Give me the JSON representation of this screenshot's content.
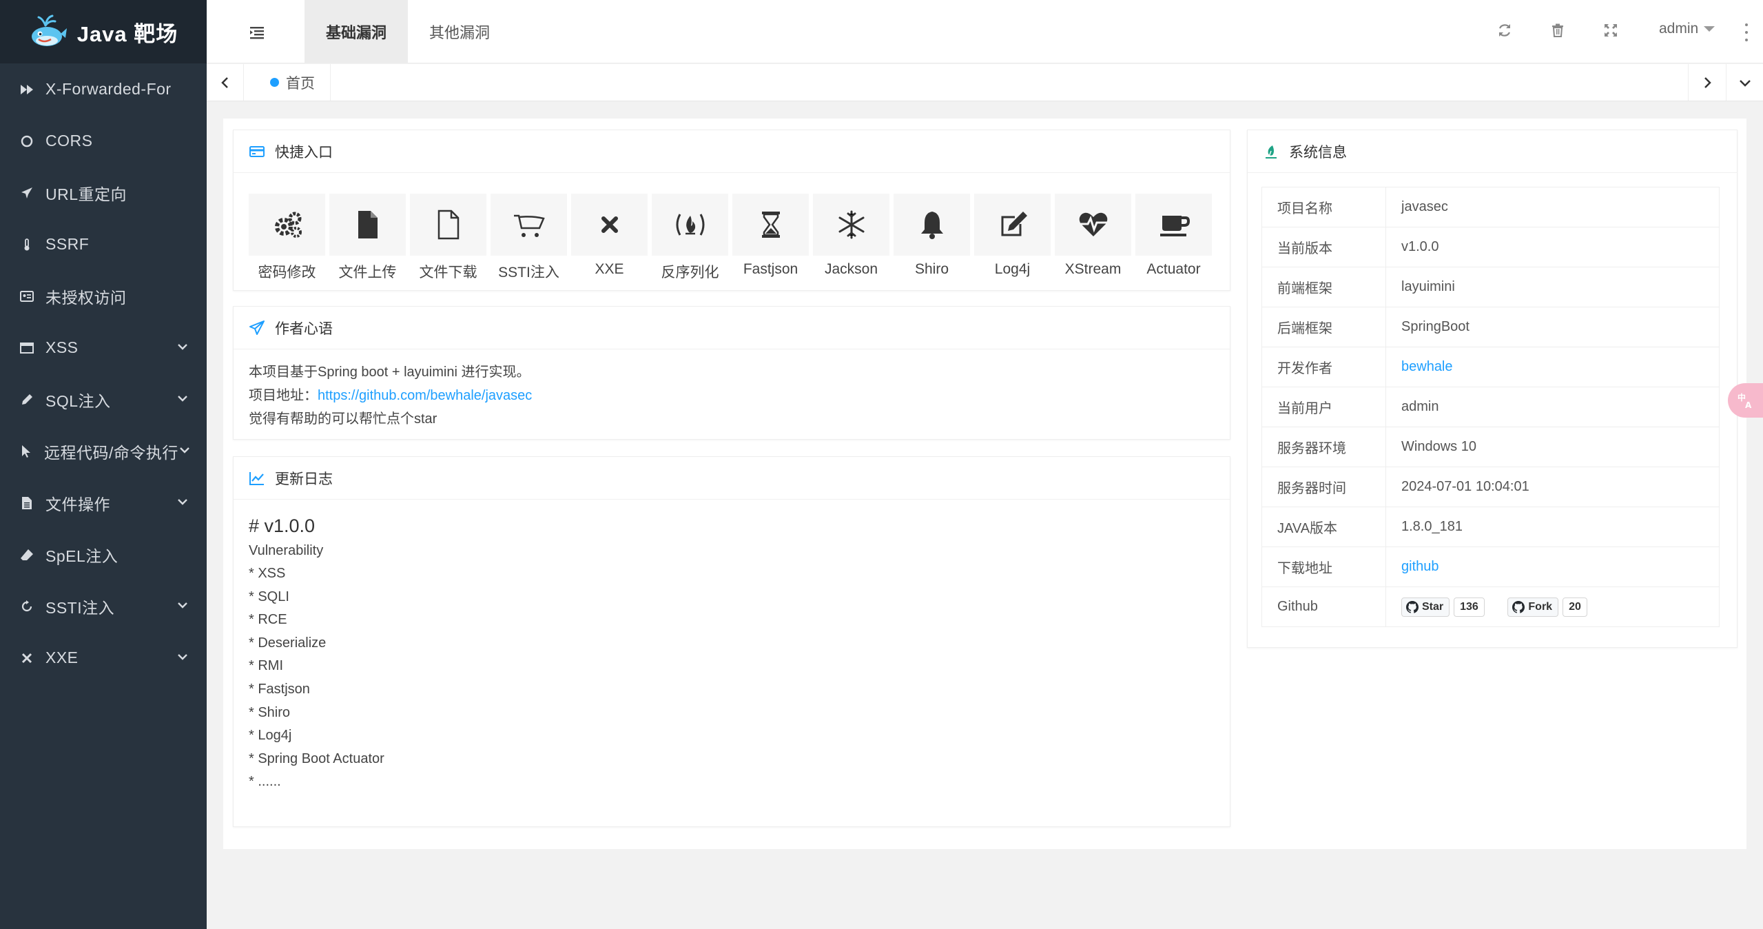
{
  "sidebar": {
    "logo_text": "Java 靶场",
    "items": [
      {
        "label": "X-Forwarded-For",
        "icon": "fast-forward-icon",
        "has_arrow": false
      },
      {
        "label": "CORS",
        "icon": "circle-icon",
        "has_arrow": false
      },
      {
        "label": "URL重定向",
        "icon": "plane-icon",
        "has_arrow": false
      },
      {
        "label": "SSRF",
        "icon": "thermometer-icon",
        "has_arrow": false
      },
      {
        "label": "未授权访问",
        "icon": "id-card-icon",
        "has_arrow": false
      },
      {
        "label": "XSS",
        "icon": "window-icon",
        "has_arrow": true
      },
      {
        "label": "SQL注入",
        "icon": "eyedropper-icon",
        "has_arrow": true
      },
      {
        "label": "远程代码/命令执行",
        "icon": "cursor-icon",
        "has_arrow": true
      },
      {
        "label": "文件操作",
        "icon": "file-icon",
        "has_arrow": true
      },
      {
        "label": "SpEL注入",
        "icon": "eraser-icon",
        "has_arrow": false
      },
      {
        "label": "SSTI注入",
        "icon": "sync-icon",
        "has_arrow": true
      },
      {
        "label": "XXE",
        "icon": "close-icon",
        "has_arrow": true
      }
    ]
  },
  "header": {
    "tabs": [
      "基础漏洞",
      "其他漏洞"
    ],
    "user": "admin"
  },
  "tabstrip": {
    "home_label": "首页"
  },
  "quick": {
    "title": "快捷入口",
    "items": [
      {
        "label": "密码修改",
        "icon": "gears-icon"
      },
      {
        "label": "文件上传",
        "icon": "file-icon"
      },
      {
        "label": "文件下载",
        "icon": "file-outline-icon"
      },
      {
        "label": "SSTI注入",
        "icon": "cart-icon"
      },
      {
        "label": "XXE",
        "icon": "close-icon"
      },
      {
        "label": "反序列化",
        "icon": "free-code-camp-icon"
      },
      {
        "label": "Fastjson",
        "icon": "hourglass-icon"
      },
      {
        "label": "Jackson",
        "icon": "snowflake-icon"
      },
      {
        "label": "Shiro",
        "icon": "bell-icon"
      },
      {
        "label": "Log4j",
        "icon": "edit-icon"
      },
      {
        "label": "XStream",
        "icon": "heartbeat-icon"
      },
      {
        "label": "Actuator",
        "icon": "coffee-icon"
      }
    ]
  },
  "author": {
    "title": "作者心语",
    "line1": "本项目基于Spring boot + layuimini 进行实现。",
    "line2_prefix": "项目地址：",
    "line2_link": "https://github.com/bewhale/javasec",
    "line3": "觉得有帮助的可以帮忙点个star"
  },
  "log": {
    "title": "更新日志",
    "version": "# v1.0.0",
    "subtitle": "Vulnerability",
    "lines": [
      "* XSS",
      "* SQLI",
      "* RCE",
      "* Deserialize",
      "* RMI",
      "* Fastjson",
      "* Shiro",
      "* Log4j",
      "* Spring Boot Actuator",
      "* ......"
    ]
  },
  "sys": {
    "title": "系统信息",
    "rows": [
      {
        "key": "项目名称",
        "value": "javasec"
      },
      {
        "key": "当前版本",
        "value": "v1.0.0"
      },
      {
        "key": "前端框架",
        "value": "layuimini"
      },
      {
        "key": "后端框架",
        "value": "SpringBoot"
      },
      {
        "key": "开发作者",
        "value": "bewhale"
      },
      {
        "key": "当前用户",
        "value": "admin"
      },
      {
        "key": "服务器环境",
        "value": "Windows 10"
      },
      {
        "key": "服务器时间",
        "value": "2024-07-01 10:04:01"
      },
      {
        "key": "JAVA版本",
        "value": "1.8.0_181"
      },
      {
        "key": "下载地址",
        "value": "github"
      },
      {
        "key": "Github",
        "value": ""
      }
    ],
    "github": {
      "star_label": "Star",
      "star_count": "136",
      "fork_label": "Fork",
      "fork_count": "20"
    }
  },
  "colors": {
    "sidebar_bg": "#28333e",
    "logo_bg": "#1e2730",
    "accent": "#1e9fff",
    "card_icon": "#1e9fff"
  }
}
